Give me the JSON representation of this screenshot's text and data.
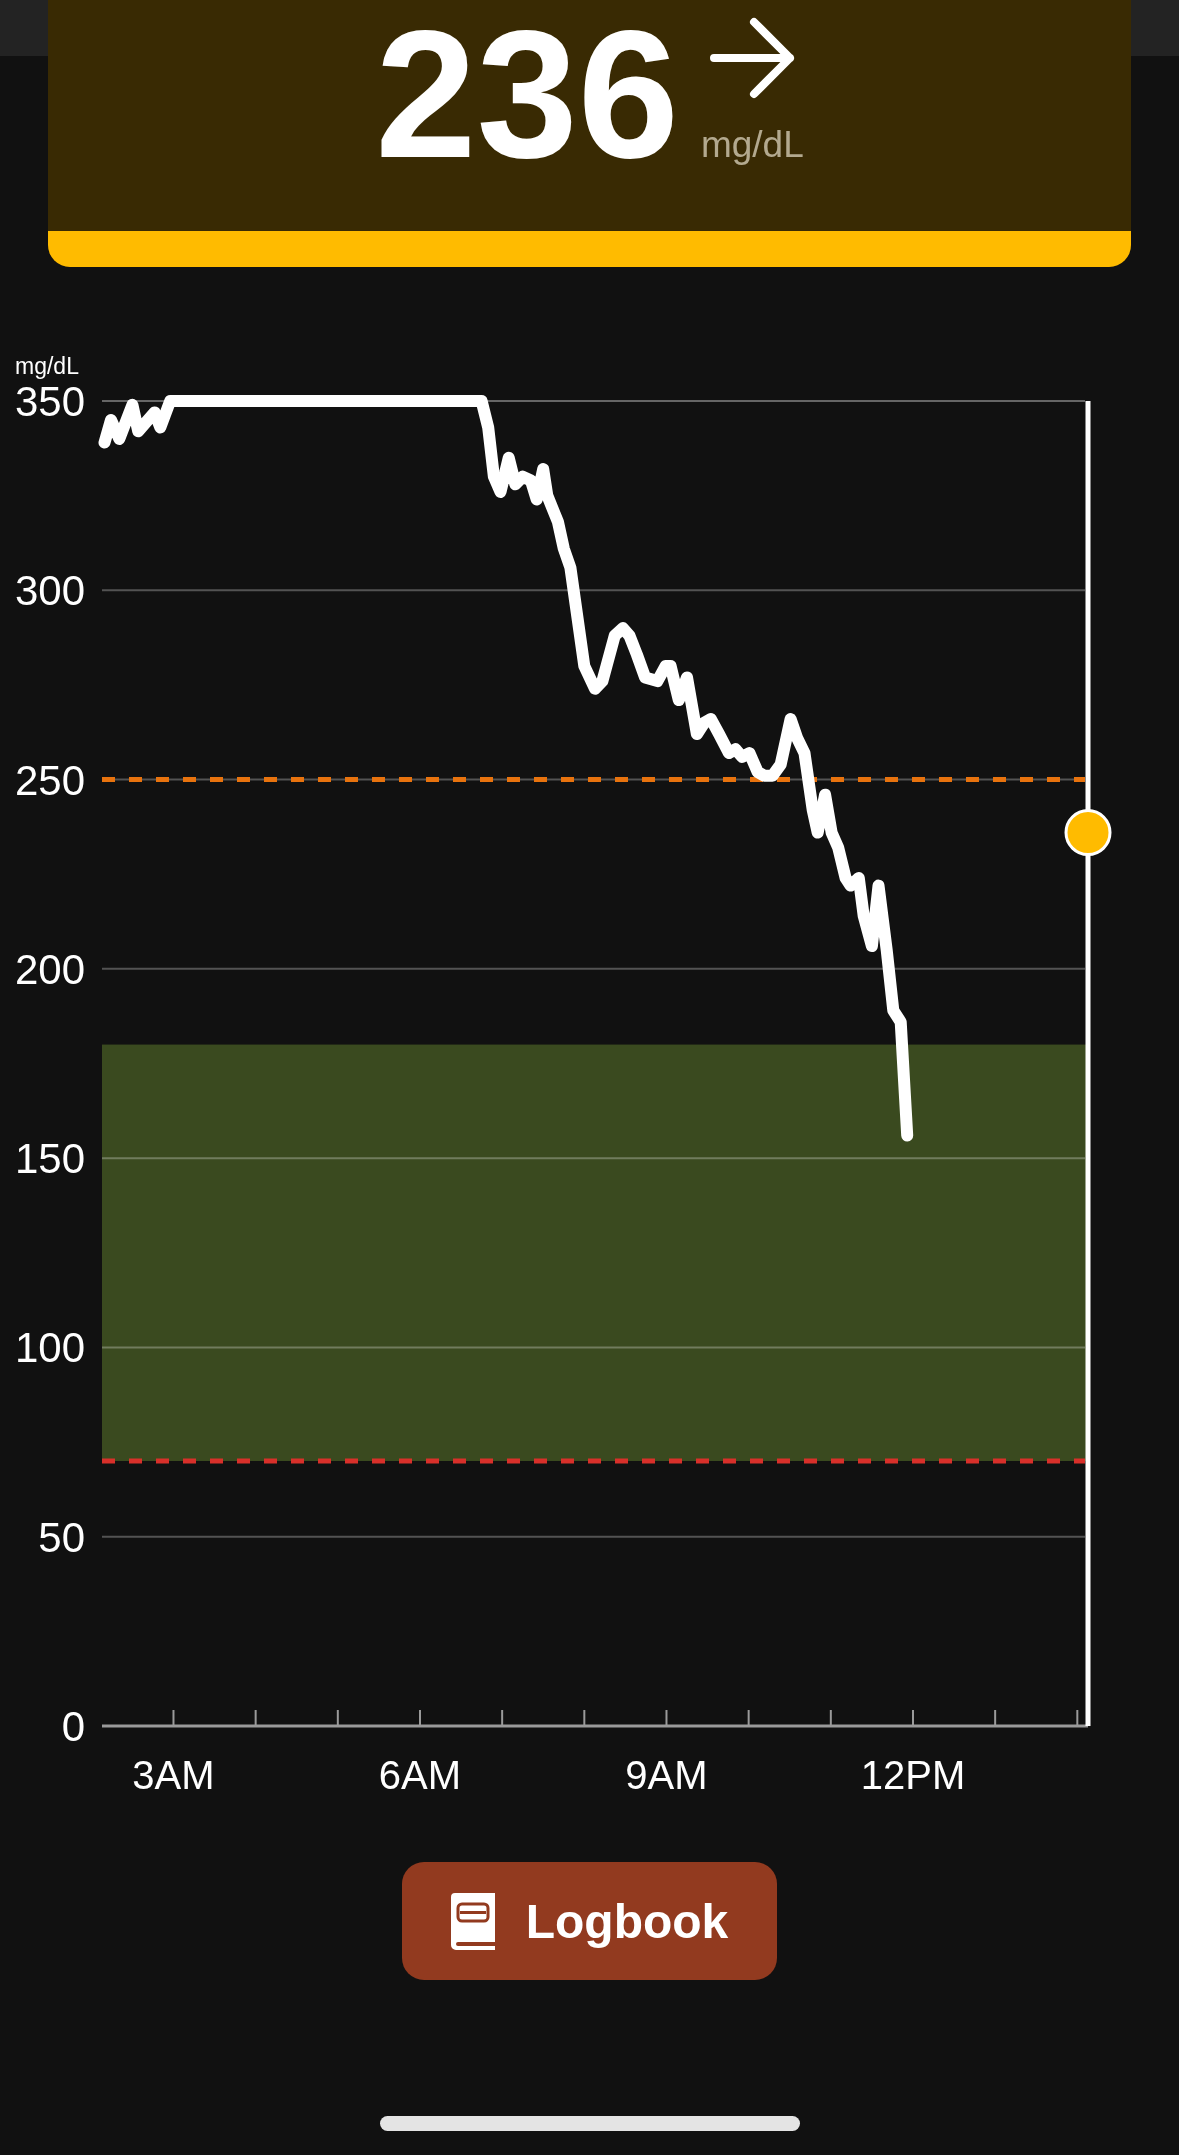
{
  "reading": {
    "value": "236",
    "unit": "mg/dL"
  },
  "chart": {
    "chart_data": {
      "type": "line",
      "ylabel": "mg/dL",
      "x": [
        2.16,
        2.24,
        2.34,
        2.5,
        2.57,
        2.77,
        2.84,
        2.96,
        6.75,
        6.83,
        6.9,
        6.98,
        7.08,
        7.16,
        7.25,
        7.35,
        7.42,
        7.5,
        7.55,
        7.68,
        7.75,
        7.83,
        8.0,
        8.13,
        8.22,
        8.37,
        8.47,
        8.55,
        8.64,
        8.74,
        8.89,
        8.99,
        9.05,
        9.15,
        9.25,
        9.37,
        9.46,
        9.54,
        9.64,
        9.76,
        9.84,
        9.92,
        10.01,
        10.11,
        10.19,
        10.29,
        10.39,
        10.51,
        10.59,
        10.68,
        10.78,
        10.84,
        10.93,
        11.01,
        11.09,
        11.18,
        11.24,
        11.34,
        11.4,
        11.5,
        11.58,
        11.68,
        11.76,
        11.85,
        11.93
      ],
      "values": [
        339,
        345,
        340,
        349,
        342,
        347,
        343,
        350,
        350,
        343,
        330,
        326,
        335,
        328,
        330,
        329,
        324,
        332,
        325,
        318,
        311,
        306,
        280,
        274,
        276,
        288,
        290,
        288,
        283,
        277,
        276,
        280,
        280,
        271,
        277,
        262,
        265,
        266,
        262,
        257,
        258,
        256,
        257,
        252,
        251,
        251,
        254,
        266,
        261,
        257,
        242,
        236,
        246,
        236,
        232,
        224,
        222,
        224,
        214,
        206,
        222,
        205,
        189,
        186,
        156
      ],
      "xlim": [
        2.13,
        14.13
      ],
      "ylim": [
        0,
        350
      ],
      "xticks": [
        {
          "value": 3,
          "label": "3AM"
        },
        {
          "value": 6,
          "label": "6AM"
        },
        {
          "value": 9,
          "label": "9AM"
        },
        {
          "value": 12,
          "label": "12PM"
        }
      ],
      "yticks": [
        0,
        50,
        100,
        150,
        200,
        250,
        300,
        350
      ],
      "grid": true,
      "bands": [
        {
          "axis": "y",
          "from": 70,
          "to": 180,
          "color": "#3a4a1f"
        }
      ],
      "ref_lines": [
        {
          "axis": "y",
          "value": 250,
          "color": "#e8730e"
        },
        {
          "axis": "y",
          "value": 70,
          "color": "#d8302a"
        }
      ]
    }
  },
  "logbook_button": {
    "label": "Logbook"
  }
}
